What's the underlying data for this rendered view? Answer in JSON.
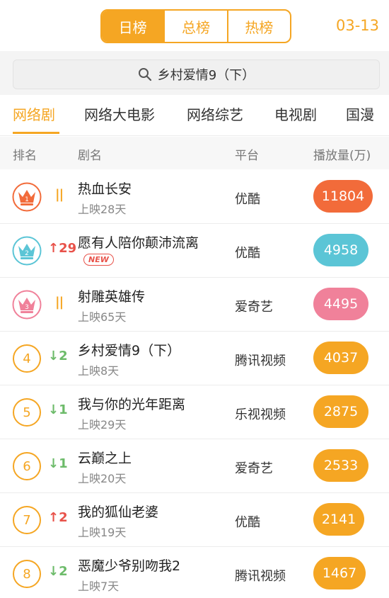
{
  "tabs": [
    {
      "label": "日榜",
      "active": true
    },
    {
      "label": "总榜",
      "active": false
    },
    {
      "label": "热榜",
      "active": false
    }
  ],
  "date": "03-13",
  "search": {
    "value": "乡村爱情9（下）"
  },
  "categories": [
    {
      "label": "网络剧",
      "active": true
    },
    {
      "label": "网络大电影",
      "active": false
    },
    {
      "label": "网络综艺",
      "active": false
    },
    {
      "label": "电视剧",
      "active": false
    },
    {
      "label": "国漫",
      "active": false
    }
  ],
  "columns": {
    "rank": "排名",
    "name": "剧名",
    "platform": "平台",
    "plays": "播放量(万)"
  },
  "rows": [
    {
      "rank": "1",
      "trend": "||",
      "trend_dir": "same",
      "title": "热血长安",
      "sub": "上映28天",
      "platform": "优酷",
      "plays": "11804",
      "pill_color": "#f26b3a",
      "crown_color": "#f26b3a"
    },
    {
      "rank": "2",
      "trend": "↑29",
      "trend_dir": "up",
      "title": "愿有人陪你颠沛流离",
      "badge": "NEW",
      "platform": "优酷",
      "plays": "4958",
      "pill_color": "#5bc5d6",
      "crown_color": "#5bc5d6"
    },
    {
      "rank": "3",
      "trend": "||",
      "trend_dir": "same",
      "title": "射雕英雄传",
      "sub": "上映65天",
      "platform": "爱奇艺",
      "plays": "4495",
      "pill_color": "#f0819a",
      "crown_color": "#f0819a"
    },
    {
      "rank": "4",
      "trend": "↓2",
      "trend_dir": "down",
      "title": "乡村爱情9（下）",
      "sub": "上映8天",
      "platform": "腾讯视频",
      "plays": "4037",
      "pill_color": "#f5a623"
    },
    {
      "rank": "5",
      "trend": "↓1",
      "trend_dir": "down",
      "title": "我与你的光年距离",
      "sub": "上映29天",
      "platform": "乐视视频",
      "plays": "2875",
      "pill_color": "#f5a623"
    },
    {
      "rank": "6",
      "trend": "↓1",
      "trend_dir": "down",
      "title": "云巅之上",
      "sub": "上映20天",
      "platform": "爱奇艺",
      "plays": "2533",
      "pill_color": "#f5a623"
    },
    {
      "rank": "7",
      "trend": "↑2",
      "trend_dir": "up",
      "title": "我的狐仙老婆",
      "sub": "上映19天",
      "platform": "优酷",
      "plays": "2141",
      "pill_color": "#f5a623"
    },
    {
      "rank": "8",
      "trend": "↓2",
      "trend_dir": "down",
      "title": "恶魔少爷别吻我2",
      "sub": "上映7天",
      "platform": "腾讯视频",
      "plays": "1467",
      "pill_color": "#f5a623"
    }
  ]
}
